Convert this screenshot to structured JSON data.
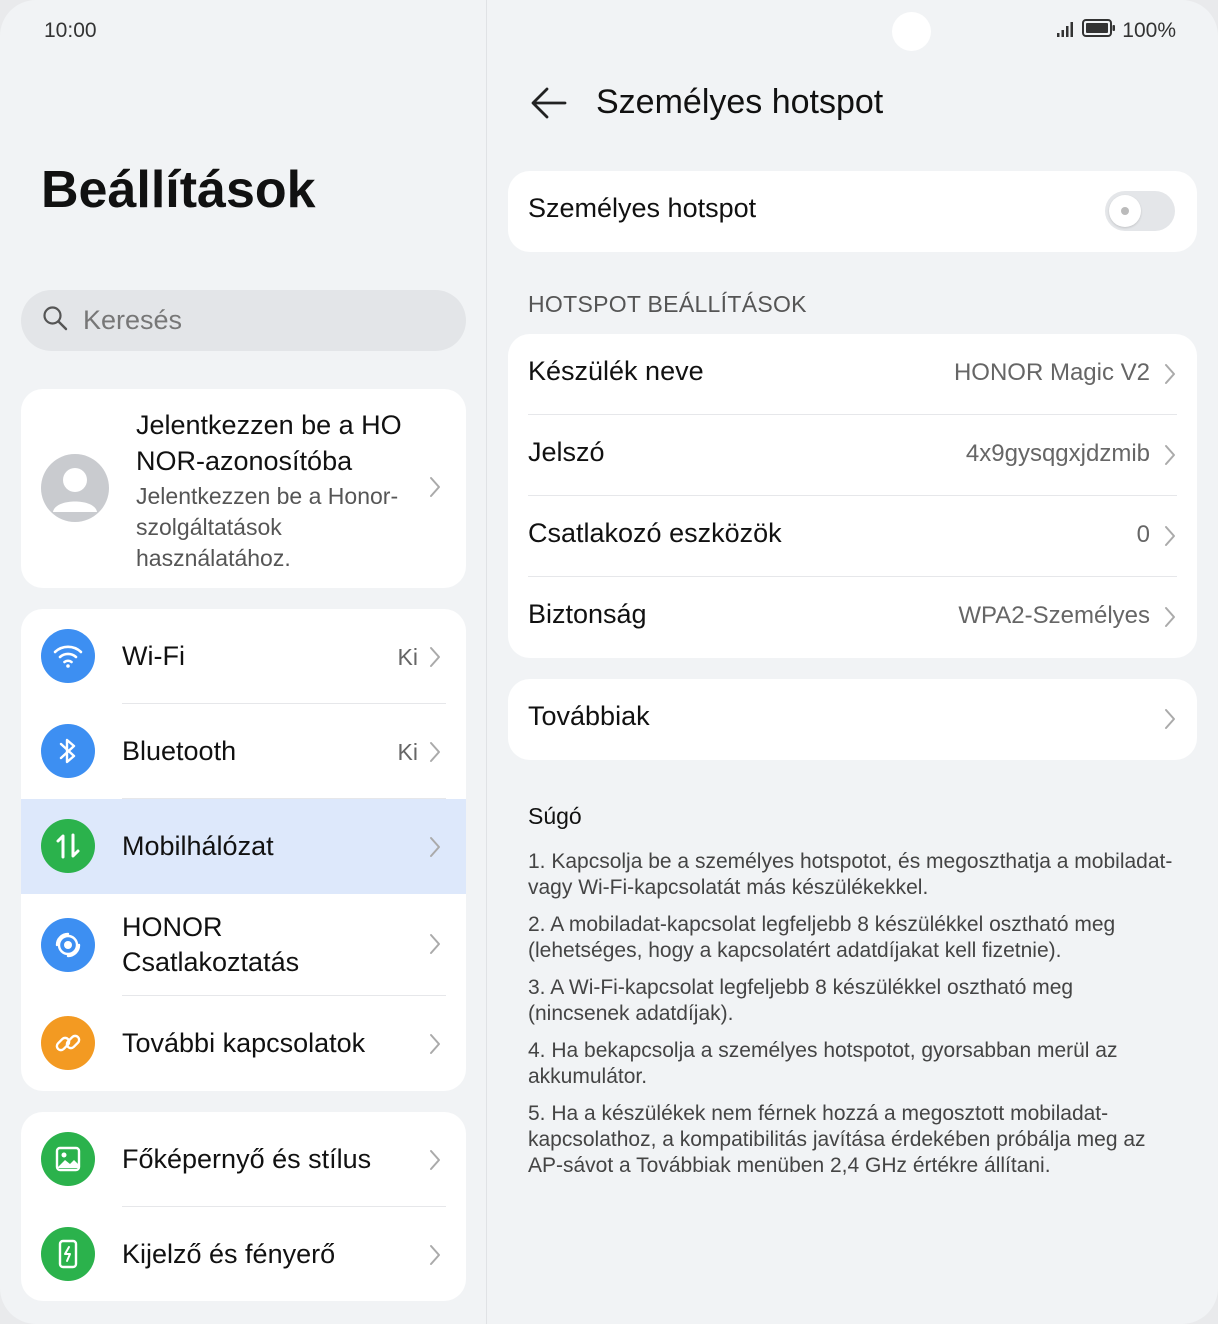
{
  "status": {
    "time": "10:00",
    "battery": "100%"
  },
  "left": {
    "title": "Beállítások",
    "search": {
      "placeholder": "Keresés"
    },
    "account": {
      "title": "Jelentkezzen be a HONOR-azonosítóba",
      "subtitle": "Jelentkezzen be a Honor-szolgáltatások használatához."
    },
    "groups": [
      [
        {
          "label": "Wi-Fi",
          "value": "Ki",
          "icon": "wifi-icon",
          "color": "#3d8ff2"
        },
        {
          "label": "Bluetooth",
          "value": "Ki",
          "icon": "bluetooth-icon",
          "color": "#3d8ff2"
        },
        {
          "label": "Mobilhálózat",
          "value": "",
          "icon": "mobile-data-icon",
          "color": "#2bb24c"
        },
        {
          "label": "HONOR Csatlakoztatás",
          "value": "",
          "icon": "honor-connect-icon",
          "color": "#3d8ff2"
        },
        {
          "label": "További kapcsolatok",
          "value": "",
          "icon": "link-icon",
          "color": "#f39a22"
        }
      ],
      [
        {
          "label": "Főképernyő és stílus",
          "value": "",
          "icon": "image-icon",
          "color": "#2bb24c"
        },
        {
          "label": "Kijelző és fényerő",
          "value": "",
          "icon": "phone-brightness-icon",
          "color": "#2bb24c"
        }
      ]
    ]
  },
  "right": {
    "title": "Személyes hotspot",
    "toggle_label": "Személyes hotspot",
    "toggle_on": false,
    "section_header": "HOTSPOT BEÁLLÍTÁSOK",
    "settings": [
      {
        "label": "Készülék neve",
        "value": "HONOR Magic V2"
      },
      {
        "label": "Jelszó",
        "value": "4x9gysqgxjdzmib"
      },
      {
        "label": "Csatlakozó eszközök",
        "value": "0"
      },
      {
        "label": "Biztonság",
        "value": "WPA2-Személyes"
      }
    ],
    "more_label": "Továbbiak",
    "help_title": "Súgó",
    "help_items": [
      "1. Kapcsolja be a személyes hotspotot, és megoszthatja a mobiladat- vagy Wi-Fi-kapcsolatát más készülékekkel.",
      "2. A mobiladat-kapcsolat legfeljebb 8 készülékkel osztható meg (lehetséges, hogy a kapcsolatért adatdíjakat kell fizetnie).",
      "3. A Wi-Fi-kapcsolat legfeljebb 8 készülékkel osztható meg (nincsenek adatdíjak).",
      "4. Ha bekapcsolja a személyes hotspotot, gyorsabban merül az akkumulátor.",
      "5. Ha a készülékek nem férnek hozzá a megosztott mobiladat-kapcsolathoz, a kompatibilitás javítása érdekében próbálja meg az AP-sávot a Továbbiak menüben 2,4 GHz értékre állítani."
    ]
  }
}
